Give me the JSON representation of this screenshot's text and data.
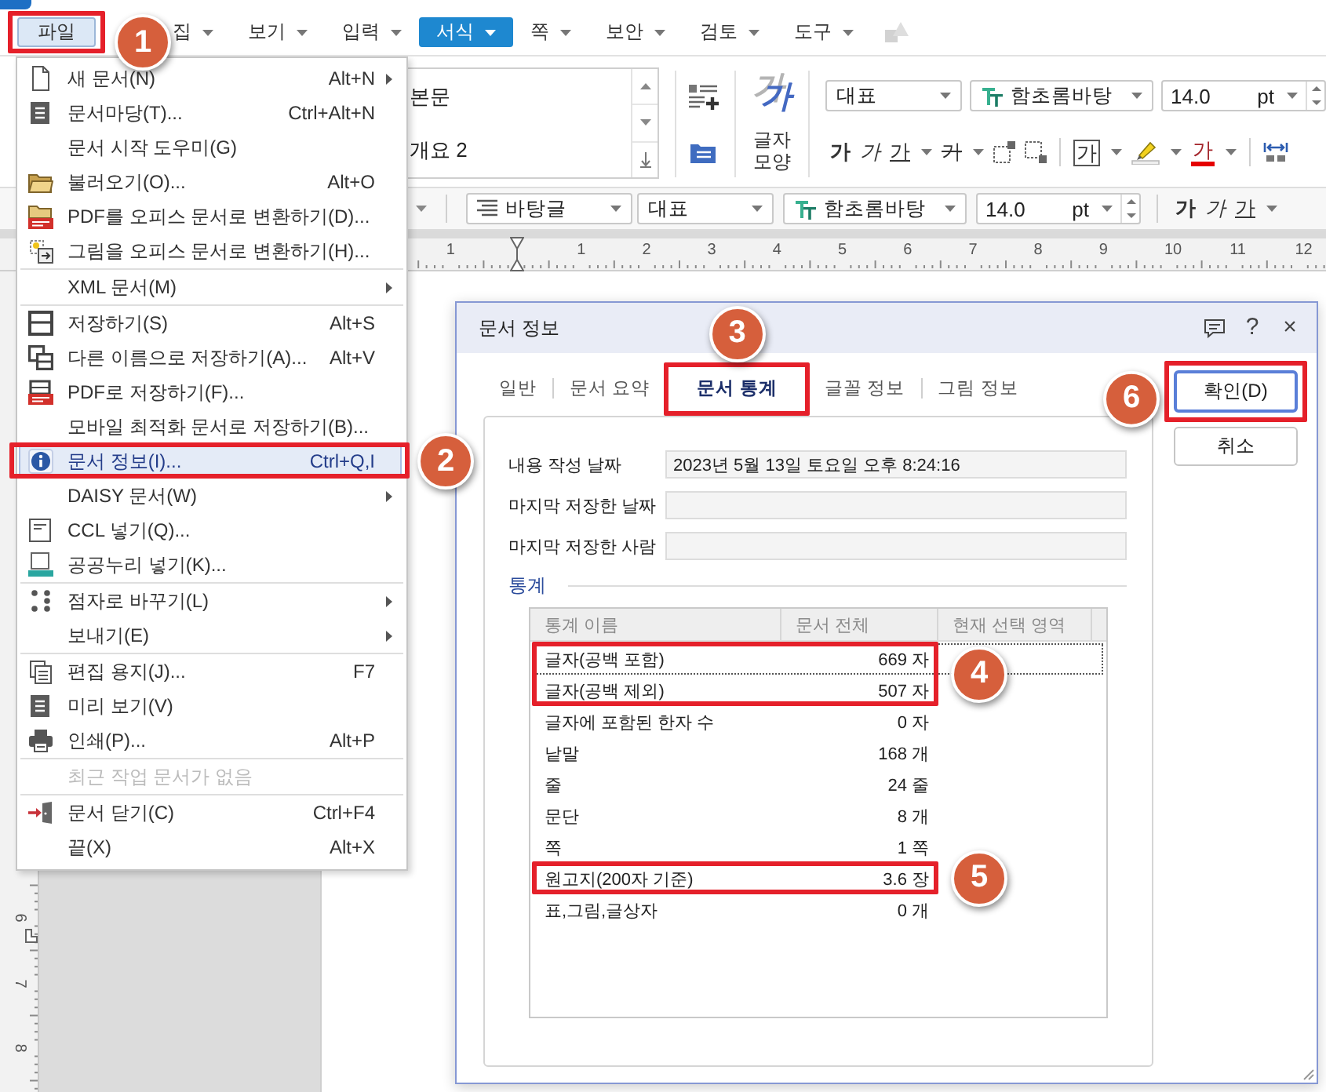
{
  "menubar": [
    {
      "label": "파일",
      "open": true,
      "selected": false,
      "dropdown": false,
      "highlighted": true,
      "badge": "1"
    },
    {
      "label": "집",
      "open": false,
      "selected": false,
      "dropdown": true,
      "highlighted": false
    },
    {
      "label": "보기",
      "open": false,
      "selected": false,
      "dropdown": true,
      "highlighted": false
    },
    {
      "label": "입력",
      "open": false,
      "selected": false,
      "dropdown": true,
      "highlighted": false
    },
    {
      "label": "서식",
      "open": false,
      "selected": true,
      "dropdown": true,
      "highlighted": false
    },
    {
      "label": "쪽",
      "open": false,
      "selected": false,
      "dropdown": true,
      "highlighted": false
    },
    {
      "label": "보안",
      "open": false,
      "selected": false,
      "dropdown": true,
      "highlighted": false
    },
    {
      "label": "검토",
      "open": false,
      "selected": false,
      "dropdown": true,
      "highlighted": false
    },
    {
      "label": "도구",
      "open": false,
      "selected": false,
      "dropdown": true,
      "highlighted": false
    }
  ],
  "ribbon": {
    "styles": [
      "본문",
      "개요 2"
    ],
    "char_shape": {
      "glyph": "가",
      "label": "글자 모양"
    },
    "font": {
      "script": "대표",
      "face": "함초롬바탕",
      "size": "14.0",
      "unit": "pt"
    },
    "format_groups": [
      [
        {
          "kind": "bold",
          "label": "가",
          "dropdown": false
        },
        {
          "kind": "italic",
          "label": "가",
          "dropdown": false
        },
        {
          "kind": "underline",
          "label": "가",
          "dropdown": true
        },
        {
          "kind": "strike",
          "label": "가",
          "dropdown": true
        },
        {
          "kind": "superscript",
          "dropdown": false
        },
        {
          "kind": "subscript",
          "dropdown": false
        }
      ],
      [
        {
          "kind": "outline",
          "label": "가",
          "dropdown": true
        },
        {
          "kind": "highlight",
          "dropdown": true
        },
        {
          "kind": "font_color",
          "label": "가",
          "dropdown": true
        }
      ],
      [
        {
          "kind": "spacing",
          "dropdown": false
        }
      ]
    ]
  },
  "toolbar": {
    "style": "바탕글",
    "font": {
      "script": "대표",
      "face": "함초롬바탕",
      "size": "14.0",
      "unit": "pt"
    },
    "format_buttons": [
      {
        "kind": "bold",
        "label": "가",
        "dropdown": false
      },
      {
        "kind": "italic",
        "label": "가",
        "dropdown": false
      },
      {
        "kind": "underline",
        "label": "가",
        "dropdown": true
      }
    ]
  },
  "horizontal_ruler": [
    "1",
    "1",
    "2",
    "3",
    "4",
    "5",
    "6",
    "7",
    "8",
    "9",
    "10",
    "11",
    "12"
  ],
  "vertical_ruler": [
    "6",
    "7",
    "8"
  ],
  "file_menu": {
    "groups": [
      [
        {
          "label": "새 문서(N)",
          "shortcut": "Alt+N",
          "submenu": true,
          "selected": false,
          "disabled": false,
          "highlighted": false
        },
        {
          "label": "문서마당(T)...",
          "shortcut": "Ctrl+Alt+N",
          "submenu": false,
          "selected": false,
          "disabled": false,
          "highlighted": false
        },
        {
          "label": "문서 시작 도우미(G)",
          "submenu": false,
          "selected": false,
          "disabled": false,
          "highlighted": false
        },
        {
          "label": "불러오기(O)...",
          "shortcut": "Alt+O",
          "submenu": false,
          "selected": false,
          "disabled": false,
          "highlighted": false
        },
        {
          "label": "PDF를 오피스 문서로 변환하기(D)...",
          "submenu": false,
          "selected": false,
          "disabled": false,
          "highlighted": false
        },
        {
          "label": "그림을 오피스 문서로 변환하기(H)...",
          "submenu": false,
          "selected": false,
          "disabled": false,
          "highlighted": false
        }
      ],
      [
        {
          "label": "XML 문서(M)",
          "submenu": true,
          "selected": false,
          "disabled": false,
          "highlighted": false
        }
      ],
      [
        {
          "label": "저장하기(S)",
          "shortcut": "Alt+S",
          "submenu": false,
          "selected": false,
          "disabled": false,
          "highlighted": false
        },
        {
          "label": "다른 이름으로 저장하기(A)...",
          "shortcut": "Alt+V",
          "submenu": false,
          "selected": false,
          "disabled": false,
          "highlighted": false
        },
        {
          "label": "PDF로 저장하기(F)...",
          "submenu": false,
          "selected": false,
          "disabled": false,
          "highlighted": false
        },
        {
          "label": "모바일 최적화 문서로 저장하기(B)...",
          "submenu": false,
          "selected": false,
          "disabled": false,
          "highlighted": false
        },
        {
          "label": "문서 정보(I)...",
          "shortcut": "Ctrl+Q,I",
          "submenu": false,
          "selected": true,
          "disabled": false,
          "highlighted": true,
          "badge": "2"
        },
        {
          "label": "DAISY 문서(W)",
          "submenu": true,
          "selected": false,
          "disabled": false,
          "highlighted": false
        },
        {
          "label": "CCL 넣기(Q)...",
          "submenu": false,
          "selected": false,
          "disabled": false,
          "highlighted": false
        },
        {
          "label": "공공누리 넣기(K)...",
          "submenu": false,
          "selected": false,
          "disabled": false,
          "highlighted": false
        }
      ],
      [
        {
          "label": "점자로 바꾸기(L)",
          "submenu": true,
          "selected": false,
          "disabled": false,
          "highlighted": false
        },
        {
          "label": "보내기(E)",
          "submenu": true,
          "selected": false,
          "disabled": false,
          "highlighted": false
        }
      ],
      [
        {
          "label": "편집 용지(J)...",
          "shortcut": "F7",
          "submenu": false,
          "selected": false,
          "disabled": false,
          "highlighted": false
        },
        {
          "label": "미리 보기(V)",
          "submenu": false,
          "selected": false,
          "disabled": false,
          "highlighted": false
        },
        {
          "label": "인쇄(P)...",
          "shortcut": "Alt+P",
          "submenu": false,
          "selected": false,
          "disabled": false,
          "highlighted": false
        }
      ],
      [
        {
          "label": "최근 작업 문서가 없음",
          "submenu": false,
          "selected": false,
          "disabled": true,
          "highlighted": false
        }
      ],
      [
        {
          "label": "문서 닫기(C)",
          "shortcut": "Ctrl+F4",
          "submenu": false,
          "selected": false,
          "disabled": false,
          "highlighted": false
        },
        {
          "label": "끝(X)",
          "shortcut": "Alt+X",
          "submenu": false,
          "selected": false,
          "disabled": false,
          "highlighted": false
        }
      ]
    ]
  },
  "dialog": {
    "title": "문서 정보",
    "help": "?",
    "close": "×",
    "tabs": [
      {
        "label": "일반",
        "selected": false,
        "highlighted": false
      },
      {
        "label": "문서 요약",
        "selected": false,
        "highlighted": false
      },
      {
        "label": "문서 통계",
        "selected": true,
        "highlighted": true,
        "badge": "3"
      },
      {
        "label": "글꼴 정보",
        "selected": false,
        "highlighted": false
      },
      {
        "label": "그림 정보",
        "selected": false,
        "highlighted": false
      }
    ],
    "fields": [
      {
        "label": "내용 작성 날짜",
        "value": "2023년 5월 13일 토요일 오후 8:24:16"
      },
      {
        "label": "마지막 저장한 날짜"
      },
      {
        "label": "마지막 저장한 사람"
      }
    ],
    "section": "통계",
    "table": {
      "columns": [
        "통계 이름",
        "문서 전체",
        "현재 선택 영역"
      ],
      "rows": [
        {
          "name": "글자(공백 포함)",
          "value": "669 자",
          "focused": true,
          "highlighted": true,
          "badge": "4"
        },
        {
          "name": "글자(공백 제외)",
          "value": "507 자",
          "focused": false,
          "highlighted": true
        },
        {
          "name": "글자에 포함된 한자 수",
          "value": "0 자",
          "focused": false,
          "highlighted": false
        },
        {
          "name": "낱말",
          "value": "168 개",
          "focused": false,
          "highlighted": false
        },
        {
          "name": "줄",
          "value": "24 줄",
          "focused": false,
          "highlighted": false
        },
        {
          "name": "문단",
          "value": "8 개",
          "focused": false,
          "highlighted": false
        },
        {
          "name": "쪽",
          "value": "1 쪽",
          "focused": false,
          "highlighted": false
        },
        {
          "name": "원고지(200자 기준)",
          "value": "3.6 장",
          "focused": false,
          "highlighted": true,
          "badge": "5"
        },
        {
          "name": "표,그림,글상자",
          "value": "0 개",
          "focused": false,
          "highlighted": false
        }
      ]
    },
    "buttons": [
      {
        "label": "확인(D)",
        "default": true,
        "highlighted": true,
        "badge": "6"
      },
      {
        "label": "취소",
        "default": false,
        "highlighted": false
      }
    ]
  }
}
